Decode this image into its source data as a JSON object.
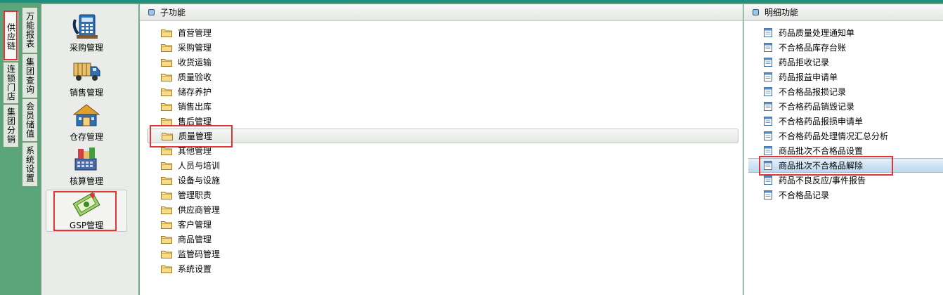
{
  "vertical_tabs_outer": [
    {
      "label": "供应链",
      "active": true
    },
    {
      "label": "连锁门店",
      "active": false
    },
    {
      "label": "集团分销",
      "active": false
    }
  ],
  "vertical_tabs_inner": [
    {
      "label": "万能报表"
    },
    {
      "label": "集团查询"
    },
    {
      "label": "会员储值"
    },
    {
      "label": "系统设置"
    }
  ],
  "modules": [
    {
      "label": "采购管理",
      "icon": "calculator-icon"
    },
    {
      "label": "销售管理",
      "icon": "truck-icon"
    },
    {
      "label": "仓存管理",
      "icon": "warehouse-icon"
    },
    {
      "label": "核算管理",
      "icon": "accounting-icon"
    },
    {
      "label": "GSP管理",
      "icon": "gsp-certificate-icon",
      "selected": true
    }
  ],
  "sub_panel": {
    "title": "子功能",
    "items": [
      "首营管理",
      "采购管理",
      "收货运输",
      "质量验收",
      "储存养护",
      "销售出库",
      "售后管理",
      "质量管理",
      "其他管理",
      "人员与培训",
      "设备与设施",
      "管理职责",
      "供应商管理",
      "客户管理",
      "商品管理",
      "监管码管理",
      "系统设置"
    ],
    "selected_index": 7
  },
  "detail_panel": {
    "title": "明细功能",
    "items": [
      "药品质量处理通知单",
      "不合格品库存台账",
      "药品拒收记录",
      "药品报益申请单",
      "不合格品报损记录",
      "不合格药品销毁记录",
      "不合格药品报损申请单",
      "不合格药品处理情况汇总分析",
      "商品批次不合格品设置",
      "商品批次不合格品解除",
      "药品不良反应/事件报告",
      "不合格品记录"
    ],
    "selected_index": 9
  },
  "colors": {
    "frame_green": "#5aa57a",
    "highlight_red": "#e03535",
    "selection_blue": "#bcd8ef"
  }
}
